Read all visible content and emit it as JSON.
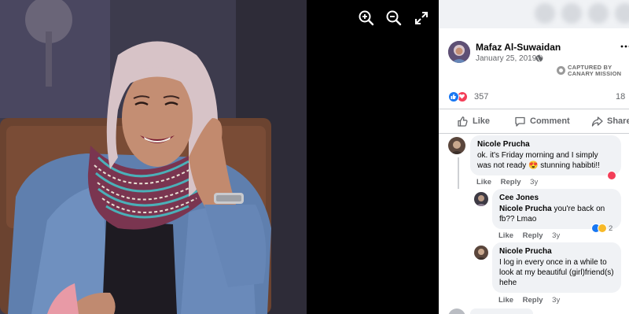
{
  "viewer": {
    "tools": [
      {
        "name": "zoom-in",
        "icon": "zoom-in-icon"
      },
      {
        "name": "zoom-out",
        "icon": "zoom-out-icon"
      },
      {
        "name": "fullscreen",
        "icon": "expand-icon"
      }
    ]
  },
  "post": {
    "author": "Mafaz Al-Suwaidan",
    "date": "January 25, 2019 · ",
    "watermark": "CAPTURED BY\nCANARY MISSION",
    "reaction_count": "357",
    "share_count": "18",
    "actions": {
      "like": "Like",
      "comment": "Comment",
      "share": "Share"
    }
  },
  "comments": [
    {
      "name": "Nicole Prucha",
      "text": "ok. it's Friday morning and I simply was not ready 😍 stunning habibti!!",
      "like": "Like",
      "reply": "Reply",
      "age": "3y"
    },
    {
      "name": "Cee Jones",
      "mention": "Nicole Prucha",
      "text": " you're back on fb?? Lmao",
      "like": "Like",
      "reply": "Reply",
      "age": "3y",
      "reaction_count": "2"
    },
    {
      "name": "Nicole Prucha",
      "text": "I log in every once in a while to look at my beautiful (girl)friend(s) hehe",
      "like": "Like",
      "reply": "Reply",
      "age": "3y"
    }
  ],
  "colors": {
    "like_blue": "#1877f2",
    "love_red": "#f33e58",
    "haha_yellow": "#f7b928",
    "muted_text": "#65676b"
  }
}
